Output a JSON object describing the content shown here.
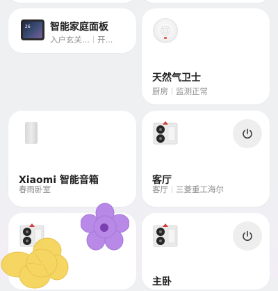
{
  "devices": [
    {
      "name": "智能家庭面板",
      "room": "入户玄关...",
      "status": "开...",
      "screen_number": "26",
      "icon": "smart-home-panel-icon"
    },
    {
      "name": "天然气卫士",
      "room": "厨房",
      "status": "监测正常",
      "icon": "gas-detector-icon"
    },
    {
      "name": "Xiaomi 智能音箱",
      "room": "春雨卧室",
      "icon": "smart-speaker-icon"
    },
    {
      "name": "客厅",
      "room": "客厅",
      "status": "三菱重工海尔",
      "icon": "air-conditioner-icon",
      "power_icon": "power-icon"
    },
    {
      "name": "",
      "room": "",
      "icon": "air-conditioner-icon"
    },
    {
      "name": "主卧",
      "room": "",
      "icon": "air-conditioner-icon",
      "power_icon": "power-icon"
    }
  ],
  "colors": {
    "card_bg": "#ffffff",
    "page_bg": "#eef0f2",
    "title_text": "#1f1f1f",
    "subtitle_text": "#8b8b8b",
    "power_button_bg": "#eeeeee",
    "sticker_purple": "#b583e6",
    "sticker_yellow": "#f5d45a"
  },
  "decorations": [
    "purple-flower-sticker",
    "yellow-flower-sticker"
  ]
}
